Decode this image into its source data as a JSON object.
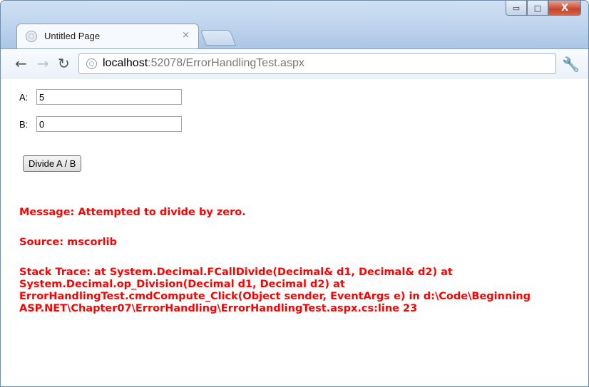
{
  "browser": {
    "tab_title": "Untitled Page",
    "tab_close": "×",
    "url_host": "localhost",
    "url_rest": ":52078/ErrorHandlingTest.aspx",
    "controls": {
      "minimize": "▭",
      "maximize": "□",
      "close": "X"
    }
  },
  "form": {
    "a_label": "A:",
    "a_value": "5",
    "b_label": "B:",
    "b_value": "0",
    "divide_button": "Divide A / B"
  },
  "error": {
    "color": "#ff0000",
    "message": "Message: Attempted to divide by zero.",
    "source": "Source: mscorlib",
    "stack_trace": "Stack Trace: at System.Decimal.FCallDivide(Decimal& d1, Decimal& d2) at System.Decimal.op_Division(Decimal d1, Decimal d2) at ErrorHandlingTest.cmdCompute_Click(Object sender, EventArgs e) in d:\\Code\\Beginning ASP.NET\\Chapter07\\ErrorHandling\\ErrorHandlingTest.aspx.cs:line 23"
  },
  "icons": {
    "back": "back-arrow-icon",
    "forward": "forward-arrow-icon",
    "reload": "reload-icon",
    "page": "page-icon",
    "wrench": "wrench-icon"
  }
}
